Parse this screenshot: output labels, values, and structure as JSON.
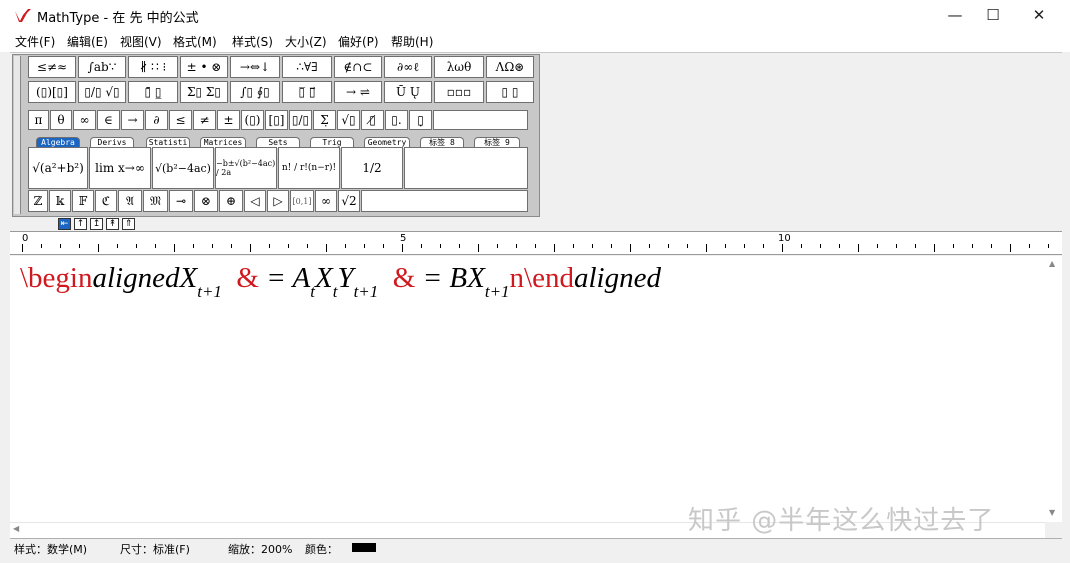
{
  "window": {
    "title": "MathType - 在 先  中的公式"
  },
  "menu": [
    "文件(F)",
    "编辑(E)",
    "视图(V)",
    "格式(M)",
    "样式(S)",
    "大小(Z)",
    "偏好(P)",
    "帮助(H)"
  ],
  "palette_row1": [
    "≤≠≈",
    "∫ab∵",
    "∦ ∷ ⁝",
    "± • ⊗",
    "→⇔↓",
    "∴∀∃",
    "∉∩⊂",
    "∂∞ℓ",
    "λωθ",
    "ΛΩ⊛"
  ],
  "palette_row2": [
    "(▯)[▯]",
    "▯/▯ √▯",
    "▯̄  ▯̲",
    "Σ▯ Σ▯",
    "∫▯ ∮▯",
    "▯̅ ▯⃗",
    "→ ⇌",
    "Ū Ų",
    "▫▫▫",
    "▯ ▯"
  ],
  "palette_row3": [
    "π",
    "θ",
    "∞",
    "∈",
    "→",
    "∂",
    "≤",
    "≠",
    "±",
    "(▯)",
    "[▯]",
    "▯/▯",
    "Σ̣",
    "√▯",
    "▯̸",
    "▯.",
    "▯̣"
  ],
  "tabs": [
    "Algebra",
    "Derivs",
    "Statisti",
    "Matrices",
    "Sets",
    "Trig",
    "Geometry",
    "标签 8",
    "标签 9"
  ],
  "templates": [
    "√(a²+b²)",
    "lim x→∞",
    "√(b²−4ac)",
    "−b±√(b²−4ac) / 2a",
    "n! / r!(n−r)!",
    "1/2"
  ],
  "small_row": [
    "ℤ",
    "𝕜",
    "𝔽",
    "ℭ",
    "𝔄",
    "𝔐",
    "⊸",
    "⊗",
    "⊕",
    "◁",
    "▷",
    "[0,1]",
    "∞",
    "√2"
  ],
  "ruler": [
    "0",
    "5",
    "10"
  ],
  "equation": {
    "p1": "\\begin",
    "p2": "aligned",
    "p3": "X",
    "s1": "t+1",
    "p4": "&",
    "p5": "= A",
    "s2": "t",
    "p6": "X",
    "s3": "t",
    "p7": "Y",
    "s4": "t+1",
    "p8": "&",
    "p9": "= BX",
    "s5": "t+1",
    "p10": "n\\end",
    "p11": "aligned"
  },
  "status": {
    "style": "样式：数学(M)",
    "size": "尺寸：标准(F)",
    "zoom": "缩放：200%",
    "color": "颜色："
  },
  "watermark": "知乎 @半年这么快过去了"
}
